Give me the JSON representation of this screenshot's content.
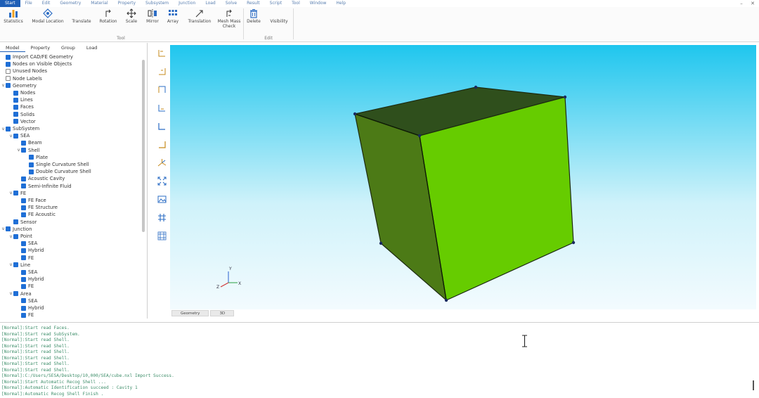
{
  "menu": {
    "items": [
      "Start",
      "File",
      "Edit",
      "Geometry",
      "Material",
      "Property",
      "Subsystem",
      "Junction",
      "Load",
      "Solve",
      "Result",
      "Script",
      "Tool",
      "Window",
      "Help"
    ],
    "active_index": 0,
    "minimize": "–",
    "close": "✕"
  },
  "ribbon": {
    "tools": [
      {
        "label": "Statistics",
        "icon": "bar-chart-icon"
      },
      {
        "label": "Modal Location",
        "icon": "modal-location-icon"
      },
      {
        "label": "Translate",
        "icon": "translate-icon"
      },
      {
        "label": "Rotation",
        "icon": "rotation-icon"
      },
      {
        "label": "Scale",
        "icon": "scale-icon"
      },
      {
        "label": "Mirror",
        "icon": "mirror-icon"
      },
      {
        "label": "Array",
        "icon": "array-icon"
      },
      {
        "label": "Translation",
        "icon": "translation-icon"
      },
      {
        "label": "Mesh Mass Check",
        "icon": "mesh-check-icon"
      },
      {
        "label": "Delete",
        "icon": "trash-icon"
      },
      {
        "label": "Visibility",
        "icon": "visibility-icon"
      }
    ],
    "groups": [
      "Tool",
      "Edit"
    ]
  },
  "left_panel": {
    "tabs": [
      "Model",
      "Property",
      "Group",
      "Load"
    ],
    "active_tab": 0,
    "tree": [
      {
        "label": "Import CAD/FE Geometry",
        "level": 0,
        "checked": true,
        "caret": ""
      },
      {
        "label": "Nodes on Visible Objects",
        "level": 0,
        "checked": true,
        "caret": ""
      },
      {
        "label": "Unused Nodes",
        "level": 0,
        "checked": false,
        "caret": ""
      },
      {
        "label": "Node Labels",
        "level": 0,
        "checked": false,
        "caret": ""
      },
      {
        "label": "Geometry",
        "level": 0,
        "checked": true,
        "caret": "v"
      },
      {
        "label": "Nodes",
        "level": 1,
        "checked": true,
        "caret": ""
      },
      {
        "label": "Lines",
        "level": 1,
        "checked": true,
        "caret": ""
      },
      {
        "label": "Faces",
        "level": 1,
        "checked": true,
        "caret": ""
      },
      {
        "label": "Solids",
        "level": 1,
        "checked": true,
        "caret": ""
      },
      {
        "label": "Vector",
        "level": 1,
        "checked": true,
        "caret": ""
      },
      {
        "label": "SubSystem",
        "level": 0,
        "checked": true,
        "caret": "v"
      },
      {
        "label": "SEA",
        "level": 1,
        "checked": true,
        "caret": "v"
      },
      {
        "label": "Beam",
        "level": 2,
        "checked": true,
        "caret": ""
      },
      {
        "label": "Shell",
        "level": 2,
        "checked": true,
        "caret": "v"
      },
      {
        "label": "Plate",
        "level": 3,
        "checked": true,
        "caret": ""
      },
      {
        "label": "Single Curvature Shell",
        "level": 3,
        "checked": true,
        "caret": ""
      },
      {
        "label": "Double Curvature Shell",
        "level": 3,
        "checked": true,
        "caret": ""
      },
      {
        "label": "Acoustic Cavity",
        "level": 2,
        "checked": true,
        "caret": ""
      },
      {
        "label": "Semi-Infinite Fluid",
        "level": 2,
        "checked": true,
        "caret": ""
      },
      {
        "label": "FE",
        "level": 1,
        "checked": true,
        "caret": "v"
      },
      {
        "label": "FE Face",
        "level": 2,
        "checked": true,
        "caret": ""
      },
      {
        "label": "FE Structure",
        "level": 2,
        "checked": true,
        "caret": ""
      },
      {
        "label": "FE Acoustic",
        "level": 2,
        "checked": true,
        "caret": ""
      },
      {
        "label": "Sensor",
        "level": 1,
        "checked": true,
        "caret": ""
      },
      {
        "label": "Junction",
        "level": 0,
        "checked": true,
        "caret": "v"
      },
      {
        "label": "Point",
        "level": 1,
        "checked": true,
        "caret": "v"
      },
      {
        "label": "SEA",
        "level": 2,
        "checked": true,
        "caret": ""
      },
      {
        "label": "Hybrid",
        "level": 2,
        "checked": true,
        "caret": ""
      },
      {
        "label": "FE",
        "level": 2,
        "checked": true,
        "caret": ""
      },
      {
        "label": "Line",
        "level": 1,
        "checked": true,
        "caret": "v"
      },
      {
        "label": "SEA",
        "level": 2,
        "checked": true,
        "caret": ""
      },
      {
        "label": "Hybrid",
        "level": 2,
        "checked": true,
        "caret": ""
      },
      {
        "label": "FE",
        "level": 2,
        "checked": true,
        "caret": ""
      },
      {
        "label": "Area",
        "level": 1,
        "checked": true,
        "caret": "v"
      },
      {
        "label": "SEA",
        "level": 2,
        "checked": true,
        "caret": ""
      },
      {
        "label": "Hybrid",
        "level": 2,
        "checked": true,
        "caret": ""
      },
      {
        "label": "FE",
        "level": 2,
        "checked": true,
        "caret": ""
      }
    ]
  },
  "viewport": {
    "tabs": [
      "Geometry",
      "3D"
    ],
    "axes": {
      "x": "X",
      "y": "Y",
      "z": "Z"
    },
    "colors": {
      "front_face": "#66cc00",
      "left_face": "#4c7a16",
      "top_face": "#2f4f1c",
      "sky_top": "#1fc6ee"
    }
  },
  "console": {
    "lines": [
      "[Normal]:Start read Faces.",
      "[Normal]:Start read SubSystem.",
      "[Normal]:Start read Shell.",
      "[Normal]:Start read Shell.",
      "[Normal]:Start read Shell.",
      "[Normal]:Start read Shell.",
      "[Normal]:Start read Shell.",
      "[Normal]:Start read Shell.",
      "[Normal]:C:/Users/SESA/Desktop/10,000/SEA/cube.nxl Import Success.",
      "[Normal]:Start Automatic Recog Shell ...",
      "[Normal]:Automatic Identification succeed : Cavity 1",
      "[Normal]:Automatic Recog Shell Finish ."
    ]
  }
}
